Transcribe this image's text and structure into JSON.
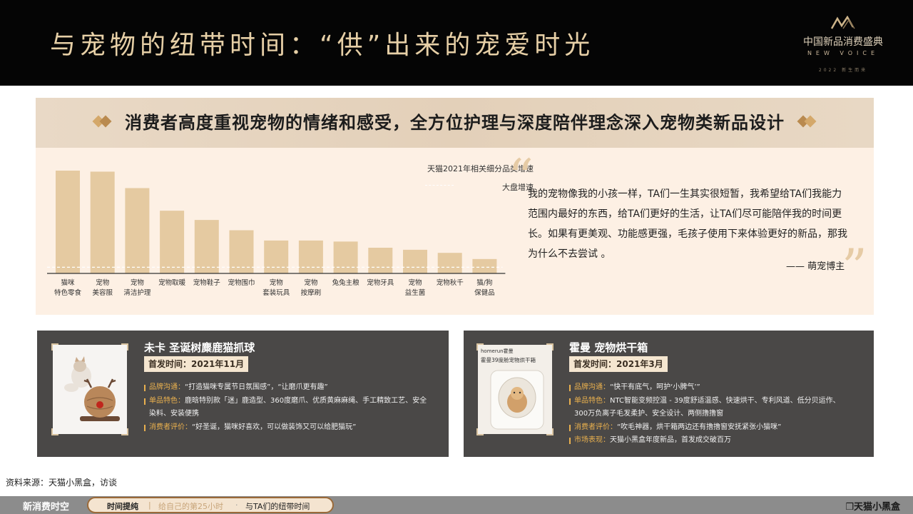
{
  "header": {
    "title": "与宠物的纽带时间：“供”出来的宠爱时光",
    "brand_name": "中国新品消费盛典",
    "brand_sub": "NEW VOICE",
    "brand_year": "2022 新生而来"
  },
  "banner": {
    "text": "消费者高度重视宠物的情绪和感受，全方位护理与深度陪伴理念深入宠物类新品设计"
  },
  "chart_data": {
    "type": "bar",
    "legend": [
      "天猫2021年相关细分品类增速",
      "大盘增速"
    ],
    "categories": [
      "猫咪\n特色零食",
      "宠物\n美容服",
      "宠物\n清洁护理",
      "宠物取暖",
      "宠物鞋子",
      "宠物围巾",
      "宠物\n套装玩具",
      "宠物\n按摩刷",
      "兔兔主粮",
      "宠物牙具",
      "宠物\n益生菌",
      "宠物秋千",
      "猫/狗\n保健品"
    ],
    "values": [
      100,
      99,
      83,
      61,
      52,
      42,
      32,
      32,
      31,
      25,
      23,
      20,
      14
    ],
    "baseline": 6,
    "ylim": [
      0,
      100
    ],
    "colors": {
      "bar": "#e5caa1",
      "baseline": "#ffffff",
      "axis": "#333333"
    }
  },
  "quote": {
    "text": "我的宠物像我的小孩一样，TA们一生其实很短暂，我希望给TA们我能力范围内最好的东西，给TA们更好的生活，让TA们尽可能陪伴我的时间更长。如果有更美观、功能感更强，毛孩子使用下来体验更好的新品，那我为什么不去尝试 。",
    "author": "—— 萌宠博主"
  },
  "products": [
    {
      "title": "未卡 圣诞树麋鹿猫抓球",
      "date": "首发时间：2021年11月",
      "bullets": [
        {
          "key": "品牌沟通：",
          "value": "“打造猫咪专属节日氛围感”，“让磨爪更有趣”"
        },
        {
          "key": "单品特色：",
          "value": "鹿晗特别款「迷」鹿造型、360度磨爪、优质黄麻麻绳、手工精致工艺、安全染料、安装便携"
        },
        {
          "key": "消费者评价：",
          "value": "“好圣诞，猫咪好喜欢，可以做装饰又可以给肥猫玩”"
        }
      ]
    },
    {
      "title": "霍曼 宠物烘干箱",
      "date": "首发时间：2021年3月",
      "photo_brand": "homerun霍曼",
      "photo_caption": "霍曼39度舱宠物烘干箱",
      "bullets": [
        {
          "key": "品牌沟通：",
          "value": "“快干有底气，呵护‘小脾气’”"
        },
        {
          "key": "单品特色：",
          "value": "NTC智能变频控温 - 39度舒适温感、快速烘干、专利风道、低分贝运作、300万负离子毛发柔护、安全设计、两侧撸撸窗"
        },
        {
          "key": "消费者评价：",
          "value": "“吹毛神器，烘干箱两边还有撸撸窗安抚紧张小猫咪”"
        },
        {
          "key": "市场表现：",
          "value": "天猫小黑盒年度新品，首发成交破百万"
        }
      ]
    }
  ],
  "footer": {
    "source": "资料来源：天猫小黑盒，访谈",
    "brand": "新消费时空",
    "nav": [
      "时间提纯",
      "给自己的第25小时",
      "与TA们的纽带时间"
    ],
    "logo": "天猫小黑盒"
  }
}
